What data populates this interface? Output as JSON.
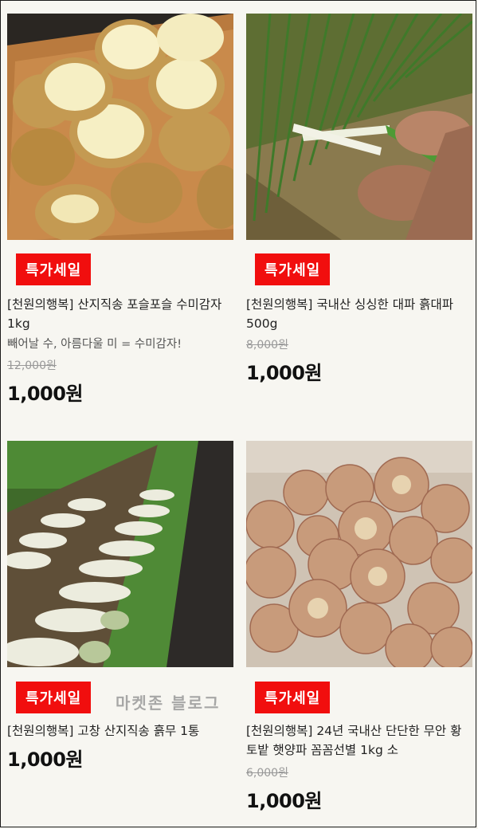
{
  "products": [
    {
      "badge": "특가세일",
      "title": "[천원의행복] 산지직송 포슬포슬 수미감자 1kg",
      "desc": "빼어날 수, 아름다울 미 = 수미감자!",
      "original_price": "12,000원",
      "price": "1,000원",
      "image": "potato-image"
    },
    {
      "badge": "특가세일",
      "title": "[천원의행복] 국내산 싱싱한 대파 흙대파 500g",
      "original_price": "8,000원",
      "price": "1,000원",
      "image": "green-onion-image"
    },
    {
      "badge": "특가세일",
      "title": "[천원의행복] 고창 산지직송 흙무 1통",
      "price": "1,000원",
      "image": "radish-image"
    },
    {
      "badge": "특가세일",
      "title": "[천원의행복] 24년 국내산 단단한 무안 황토밭 햇양파 꼼꼼선별 1kg 소",
      "original_price": "6,000원",
      "price": "1,000원",
      "image": "onion-image"
    }
  ],
  "watermark": "마켓존 블로그",
  "colors": {
    "badge": "#f10e0e",
    "background": "#f7f6f1"
  }
}
